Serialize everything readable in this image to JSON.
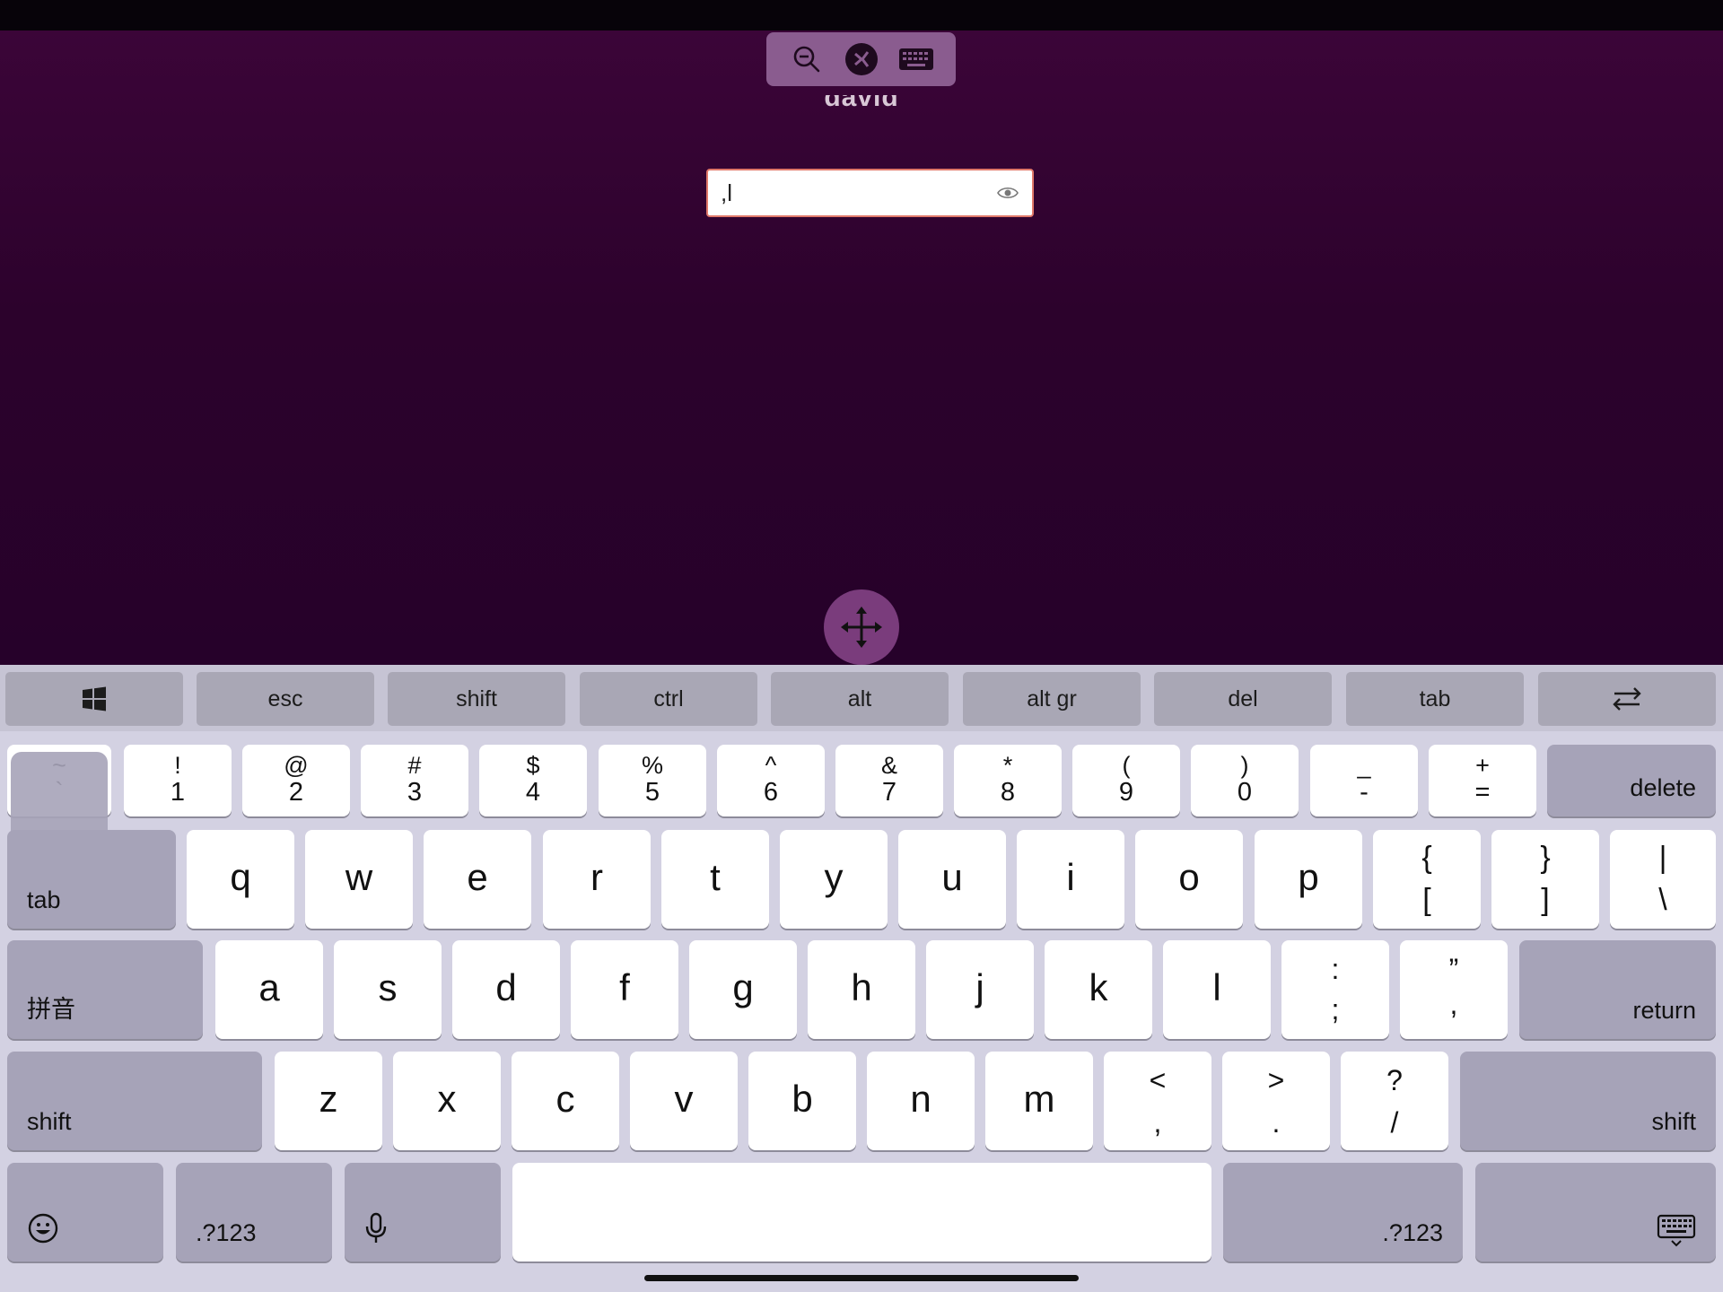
{
  "remote": {
    "username": "david",
    "password_value": ",l",
    "toolbar": {
      "zoom_out_icon": "zoom-out-icon",
      "rd_icon": "remote-desktop-icon",
      "keyboard_icon": "keyboard-icon"
    }
  },
  "modifier_bar": [
    {
      "name": "windows-key",
      "label": "",
      "icon": "windows-icon"
    },
    {
      "name": "esc-key",
      "label": "esc"
    },
    {
      "name": "shift-modifier-key",
      "label": "shift"
    },
    {
      "name": "ctrl-key",
      "label": "ctrl"
    },
    {
      "name": "alt-key",
      "label": "alt"
    },
    {
      "name": "alt-gr-key",
      "label": "alt gr"
    },
    {
      "name": "del-key",
      "label": "del"
    },
    {
      "name": "tab-modifier-key",
      "label": "tab"
    },
    {
      "name": "swap-key",
      "label": "",
      "icon": "swap-arrows-icon"
    }
  ],
  "number_row": [
    {
      "top": "~",
      "bottom": "`"
    },
    {
      "top": "!",
      "bottom": "1"
    },
    {
      "top": "@",
      "bottom": "2"
    },
    {
      "top": "#",
      "bottom": "3"
    },
    {
      "top": "$",
      "bottom": "4"
    },
    {
      "top": "%",
      "bottom": "5"
    },
    {
      "top": "^",
      "bottom": "6"
    },
    {
      "top": "&",
      "bottom": "7"
    },
    {
      "top": "*",
      "bottom": "8"
    },
    {
      "top": "(",
      "bottom": "9"
    },
    {
      "top": ")",
      "bottom": "0"
    },
    {
      "top": "_",
      "bottom": "-"
    },
    {
      "top": "+",
      "bottom": "="
    }
  ],
  "delete_label": "delete",
  "tab_label": "tab",
  "qwerty_row": [
    "q",
    "w",
    "e",
    "r",
    "t",
    "y",
    "u",
    "i",
    "o",
    "p"
  ],
  "bracket_keys": [
    {
      "top": "{",
      "bottom": "["
    },
    {
      "top": "}",
      "bottom": "]"
    },
    {
      "top": "|",
      "bottom": "\\"
    }
  ],
  "pinyin_label": "拼音",
  "home_row": [
    "a",
    "s",
    "d",
    "f",
    "g",
    "h",
    "j",
    "k",
    "l"
  ],
  "home_punct": [
    {
      "top": ":",
      "bottom": ";"
    },
    {
      "top": "”",
      "bottom": ","
    }
  ],
  "return_label": "return",
  "shift_label": "shift",
  "bottom_row": [
    "z",
    "x",
    "c",
    "v",
    "b",
    "n",
    "m"
  ],
  "bottom_punct": [
    {
      "top": "<",
      "bottom": ","
    },
    {
      "top": ">",
      "bottom": "."
    },
    {
      "top": "?",
      "bottom": "/"
    }
  ],
  "numbers_label": ".?123",
  "colors": {
    "remote_bg": "#2c022c",
    "toolbar": "#8a5c8f",
    "field_border": "#e0796a",
    "dark_key": "#a6a3b8",
    "light_key": "#ffffff"
  }
}
